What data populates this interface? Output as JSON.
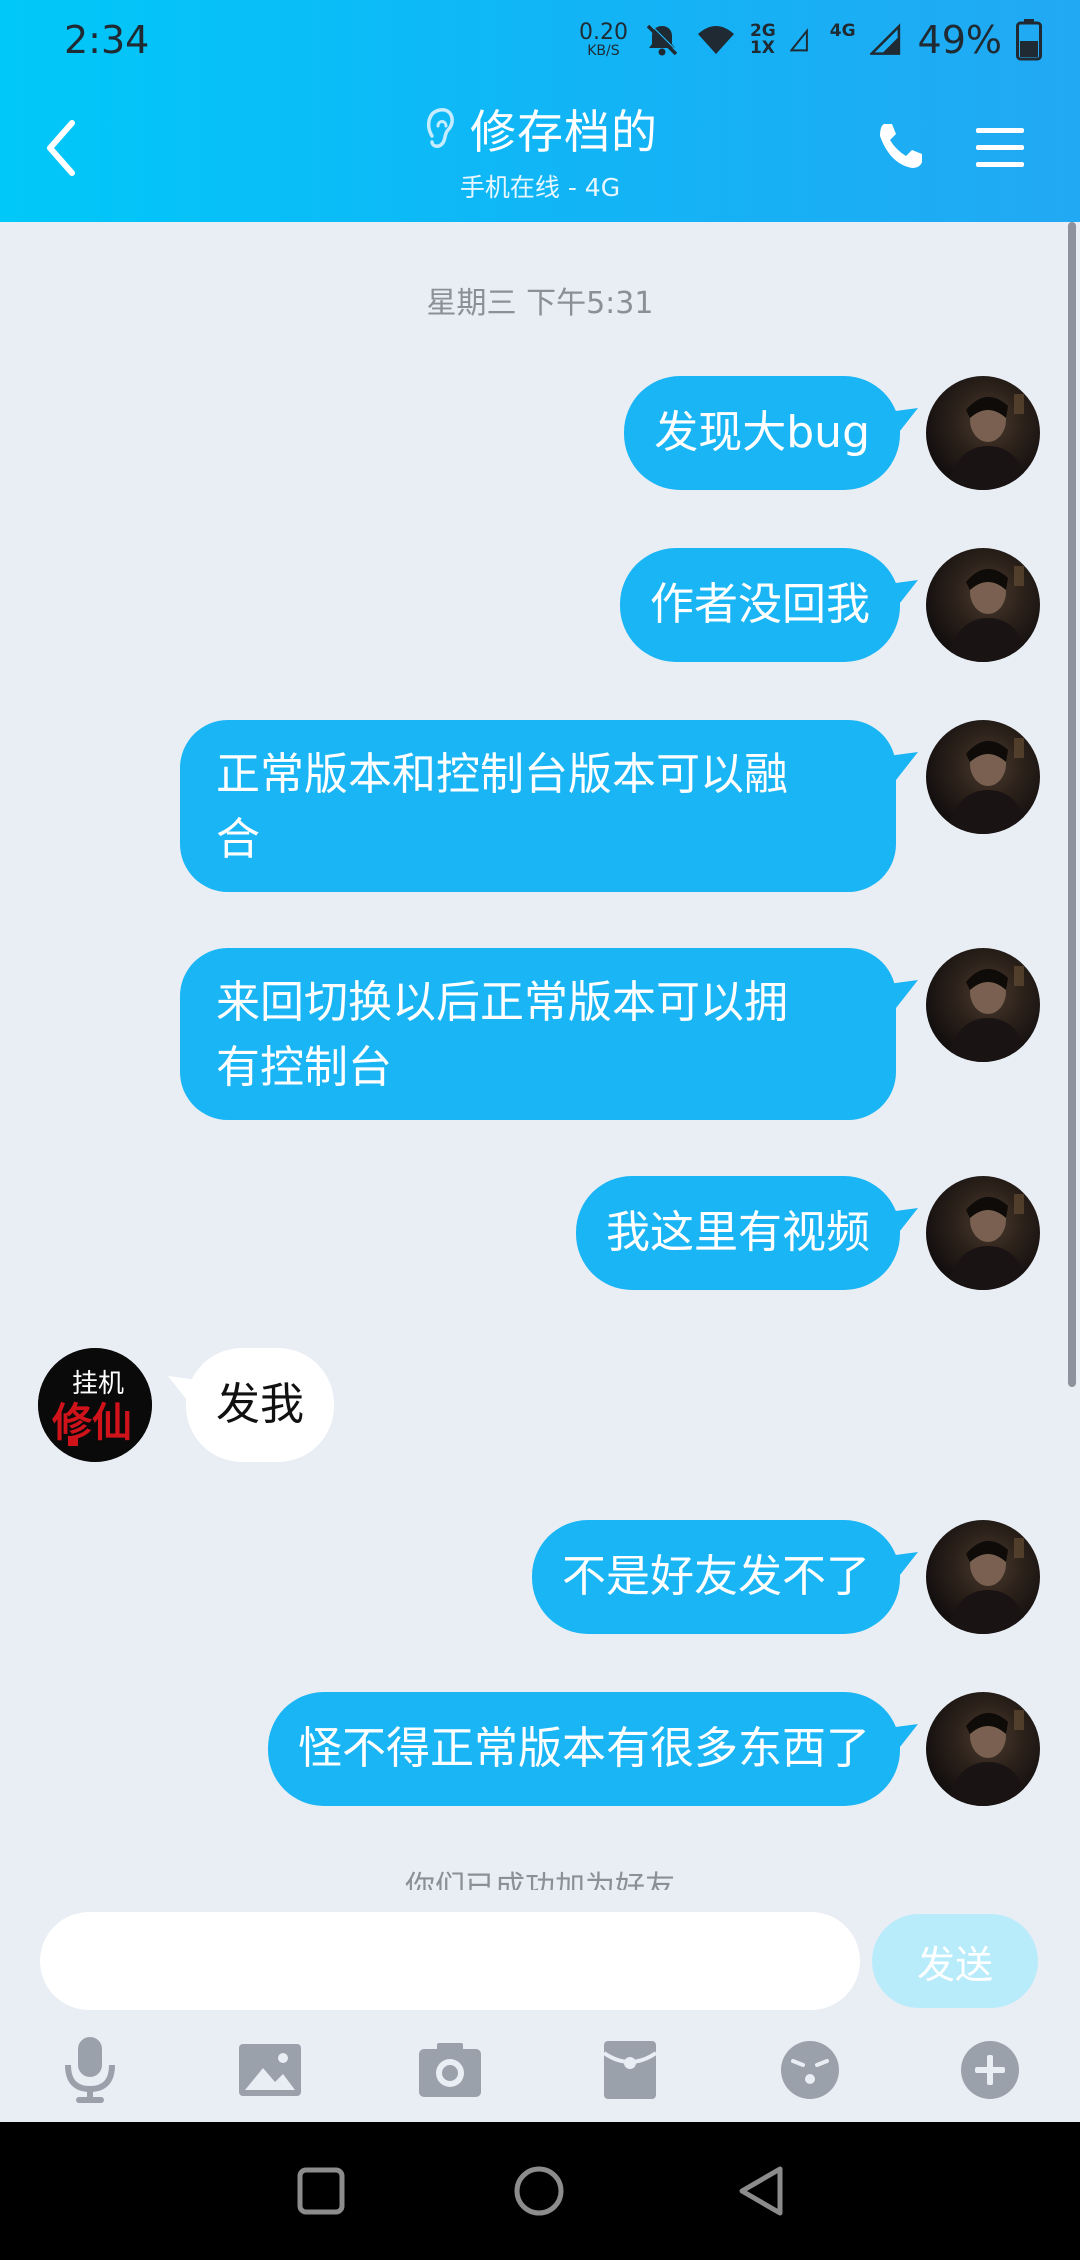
{
  "status_bar": {
    "time": "2:34",
    "net_speed_value": "0.20",
    "net_speed_unit": "KB/S",
    "sig1_top": "2G",
    "sig1_bottom": "1X",
    "sig2_top": "4G",
    "battery": "49%"
  },
  "header": {
    "title": "修存档的",
    "subtitle": "手机在线 - 4G"
  },
  "chat": {
    "timestamp": "星期三 下午5:31",
    "messages": [
      {
        "from": "me",
        "text": "发现大bug"
      },
      {
        "from": "me",
        "text": "作者没回我"
      },
      {
        "from": "me",
        "text": "正常版本和控制台版本可以融合"
      },
      {
        "from": "me",
        "text": "来回切换以后正常版本可以拥有控制台"
      },
      {
        "from": "me",
        "text": "我这里有视频"
      },
      {
        "from": "them",
        "text": "发我"
      },
      {
        "from": "me",
        "text": "不是好友发不了"
      },
      {
        "from": "me",
        "text": "怪不得正常版本有很多东西了"
      }
    ],
    "line3a": "正常版本和控制台版本可以融",
    "line3b": "合",
    "line4a": "来回切换以后正常版本可以拥",
    "line4b": "有控制台",
    "system_notice": "你们已成功加为好友",
    "them_avatar_text_top": "挂机",
    "them_avatar_text_main": "修仙"
  },
  "input": {
    "placeholder": "",
    "send_label": "发送"
  },
  "colors": {
    "header_start": "#00c8f8",
    "header_end": "#22a9f3",
    "bubble_out": "#1ab5f5",
    "bubble_in": "#ffffff",
    "chat_bg": "#e9edf4",
    "send_disabled": "#b9ecfb"
  },
  "icons": {
    "toolbar": [
      "microphone-icon",
      "image-icon",
      "camera-icon",
      "red-packet-icon",
      "emoji-icon",
      "plus-icon"
    ],
    "nav": [
      "recents-icon",
      "home-icon",
      "back-icon"
    ]
  }
}
